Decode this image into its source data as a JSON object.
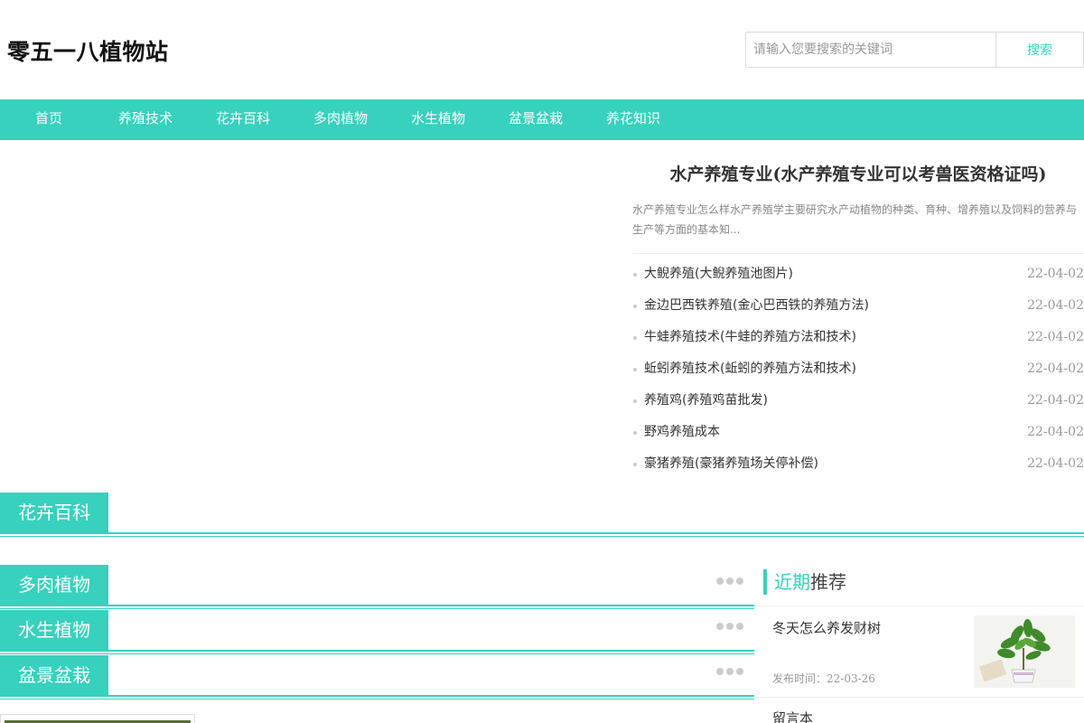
{
  "site": {
    "logo": "零五一八植物站"
  },
  "search": {
    "placeholder": "请输入您要搜索的关键词",
    "button": "搜索"
  },
  "nav": [
    "首页",
    "养殖技术",
    "花卉百科",
    "多肉植物",
    "水生植物",
    "盆景盆栽",
    "养花知识"
  ],
  "feature": {
    "title": "水产养殖专业(水产养殖专业可以考兽医资格证吗)",
    "desc": "水产养殖专业怎么样水产养殖学主要研究水产动植物的种类、育种、增养殖以及饲料的营养与生产等方面的基本知..."
  },
  "news": [
    {
      "title": "大鲵养殖(大鲵养殖池图片)",
      "date": "22-04-02"
    },
    {
      "title": "金边巴西铁养殖(金心巴西铁的养殖方法)",
      "date": "22-04-02"
    },
    {
      "title": "牛蛙养殖技术(牛蛙的养殖方法和技术)",
      "date": "22-04-02"
    },
    {
      "title": "蚯蚓养殖技术(蚯蚓的养殖方法和技术)",
      "date": "22-04-02"
    },
    {
      "title": "养殖鸡(养殖鸡苗批发)",
      "date": "22-04-02"
    },
    {
      "title": "野鸡养殖成本",
      "date": "22-04-02"
    },
    {
      "title": "豪猪养殖(豪猪养殖场关停补偿)",
      "date": "22-04-02"
    }
  ],
  "sections": [
    "花卉百科",
    "多肉植物",
    "水生植物",
    "盆景盆栽"
  ],
  "sidebar": {
    "head_highlight": "近期",
    "head_rest": "推荐",
    "items": [
      {
        "title": "冬天怎么养发财树",
        "date_label": "发布时间：22-03-26"
      },
      {
        "title": "留言本"
      }
    ]
  },
  "icons": {
    "more": "more-dots-icon",
    "thumb": "plant-photo"
  },
  "colors": {
    "accent": "#38d1bd"
  }
}
